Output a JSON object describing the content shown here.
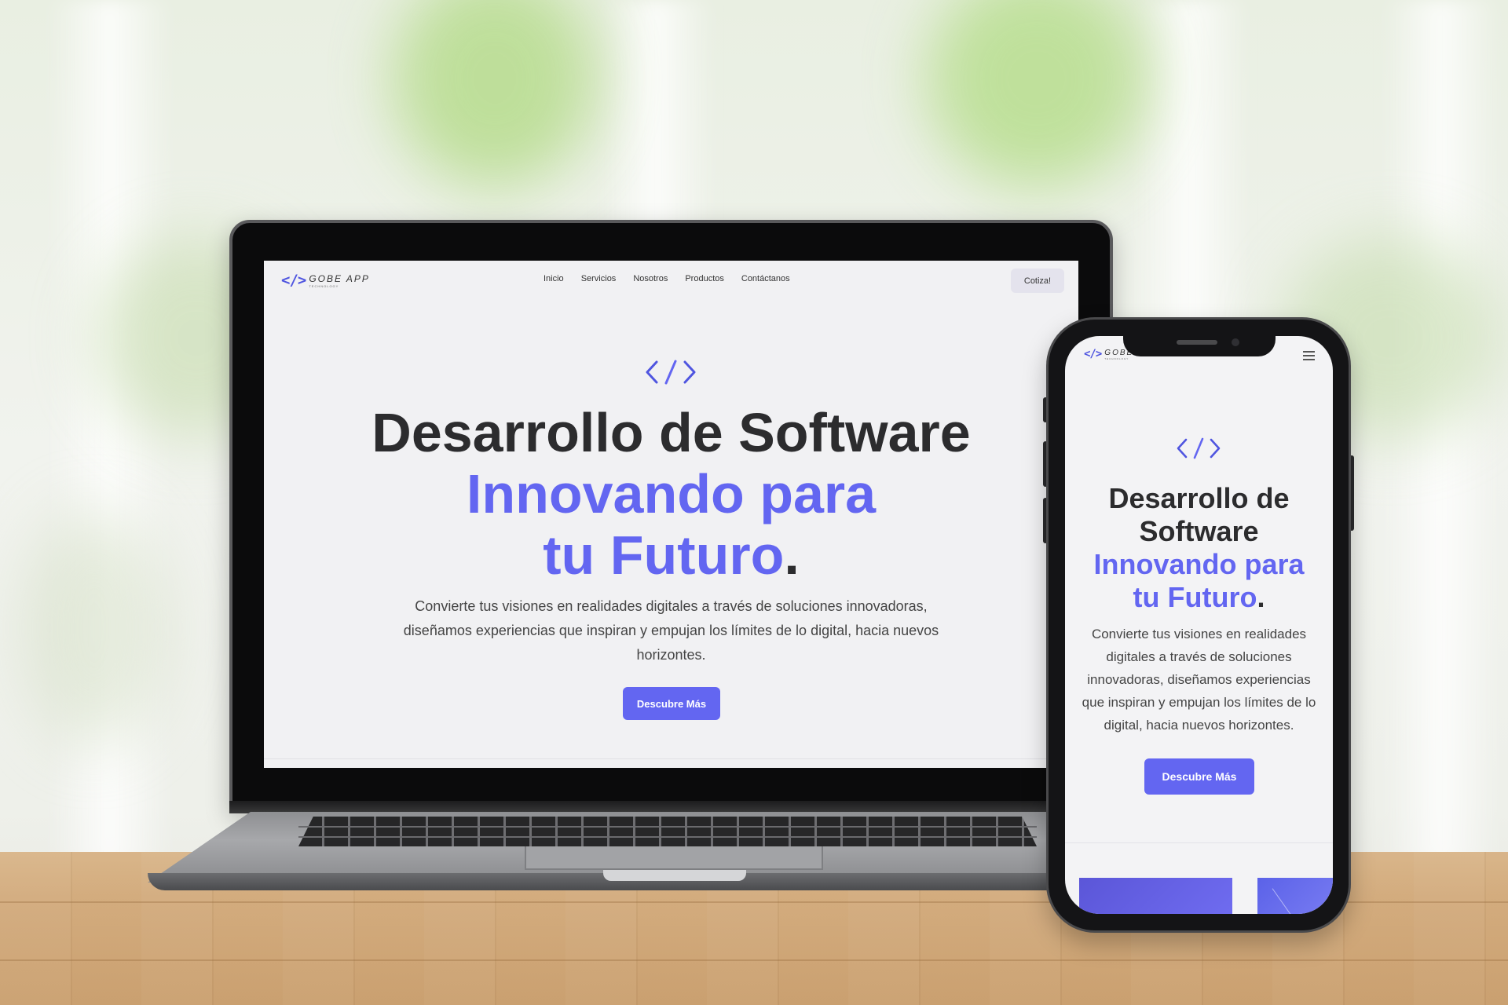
{
  "colors": {
    "accent": "#6366f1",
    "text_dark": "#2c2c2e",
    "cta_bg": "#e4e3ed"
  },
  "brand": {
    "icon": "code-brackets-icon",
    "name": "GOBE APP",
    "tagline": "TECHNOLOGY"
  },
  "desktop": {
    "nav": {
      "items": [
        "Inicio",
        "Servicios",
        "Nosotros",
        "Productos",
        "Contáctanos"
      ],
      "cta_label": "Cotiza!"
    },
    "hero": {
      "icon": "code-brackets-icon",
      "title_line1": "Desarrollo de Software",
      "title_accent": "Innovando para tu Futuro",
      "title_period": ".",
      "description": "Convierte tus visiones en realidades digitales a través de soluciones innovadoras, diseñamos experiencias que inspiran y empujan los límites de lo digital, hacia nuevos horizontes.",
      "button_label": "Descubre Más"
    }
  },
  "mobile": {
    "nav": {
      "menu_icon": "hamburger-menu-icon"
    },
    "hero": {
      "icon": "code-brackets-icon",
      "title_line1": "Desarrollo de Software",
      "title_accent": "Innovando para tu Futuro",
      "title_period": ".",
      "description": "Convierte tus visiones en realidades digitales a través de soluciones innovadoras, diseñamos experiencias que inspiran y empujan los límites de lo digital, hacia nuevos horizontes.",
      "button_label": "Descubre Más"
    }
  }
}
